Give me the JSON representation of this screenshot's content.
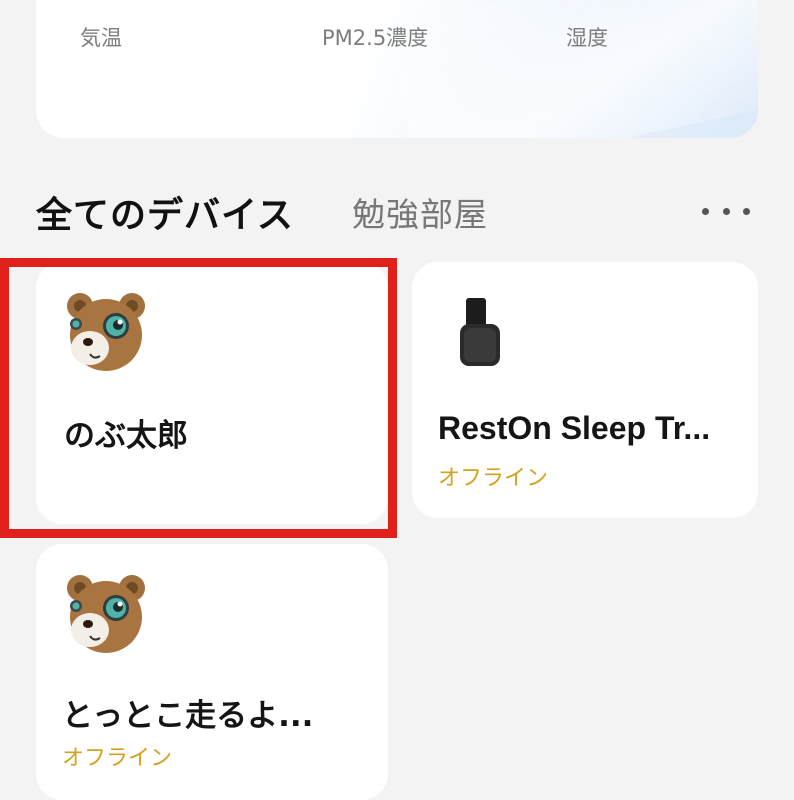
{
  "weather": {
    "temp_label": "気温",
    "pm_label": "PM2.5濃度",
    "humidity_label": "湿度"
  },
  "tabs": {
    "all": "全てのデバイス",
    "room": "勉強部屋"
  },
  "devices": [
    {
      "name": "のぶ太郎",
      "status": "",
      "icon": "bear-icon"
    },
    {
      "name": "RestOn Sleep Tr...",
      "status": "オフライン",
      "icon": "sleep-tracker-icon"
    },
    {
      "name": "とっとこ走るよ...",
      "status": "オフライン",
      "icon": "bear-icon"
    }
  ],
  "colors": {
    "highlight": "#e0201b",
    "offline": "#d3a21f",
    "background": "#f3f3f3"
  }
}
